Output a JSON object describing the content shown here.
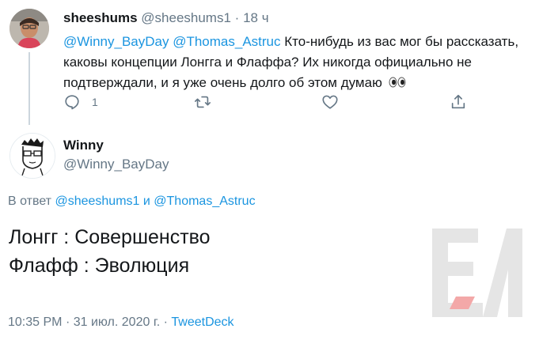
{
  "reply_tweet": {
    "display_name": "sheeshums",
    "handle": "@sheeshums1",
    "separator": "·",
    "time_ago": "18 ч",
    "mention_1": "@Winny_BayDay",
    "mention_2": "@Thomas_Astruc",
    "text": "Кто-нибудь из вас мог бы рассказать, каковы концепции Лонгга и Флаффа? Их никогда официально не подтверждали, и я уже очень долго об этом думаю",
    "emoji": "eyes-emoji",
    "actions": {
      "reply_count": "1",
      "icons": [
        "reply-icon",
        "retweet-icon",
        "like-icon",
        "share-icon"
      ]
    }
  },
  "main_tweet": {
    "display_name": "Winny",
    "handle": "@Winny_BayDay",
    "reply_prefix": "В ответ",
    "reply_mention_1": "@sheeshums1",
    "reply_conj": "и",
    "reply_mention_2": "@Thomas_Astruc",
    "line_1": "Лонгг : Совершенство",
    "line_2": "Флафф : Эволюция",
    "time": "10:35 PM",
    "dot": "·",
    "date": "31 июл. 2020 г.",
    "client": "TweetDeck"
  },
  "colors": {
    "link": "#1b95e0",
    "muted": "#657786",
    "text": "#14171a",
    "watermark": "#ef4b4b"
  }
}
